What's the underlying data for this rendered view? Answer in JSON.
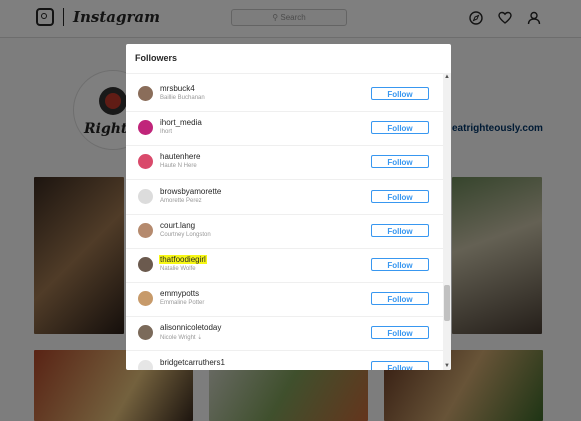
{
  "app": {
    "name": "Instagram"
  },
  "search": {
    "placeholder": "Search"
  },
  "profile": {
    "website": "eatrighteously.com",
    "logo_text": "Righteo"
  },
  "modal": {
    "title": "Followers",
    "followers": [
      {
        "username": "mrsbuck4",
        "full_name": "Baillie Buchanan",
        "button": "Follow",
        "highlight": false,
        "avatar_color": "#8a6d5a"
      },
      {
        "username": "ihort_media",
        "full_name": "Ihort",
        "button": "Follow",
        "highlight": false,
        "avatar_color": "#c0257a"
      },
      {
        "username": "hautenhere",
        "full_name": "Haute N Here",
        "button": "Follow",
        "highlight": false,
        "avatar_color": "#d94a6b"
      },
      {
        "username": "browsbyamorette",
        "full_name": "Amorette Perez",
        "button": "Follow",
        "highlight": false,
        "avatar_color": "#dcdcdc"
      },
      {
        "username": "court.lang",
        "full_name": "Courtney Longston",
        "button": "Follow",
        "highlight": false,
        "avatar_color": "#b58a6e"
      },
      {
        "username": "thatfoodiegirl",
        "full_name": "Natalie Wolfe",
        "button": "Follow",
        "highlight": true,
        "avatar_color": "#6b5a4e"
      },
      {
        "username": "emmypotts",
        "full_name": "Emmaline Potter",
        "button": "Follow",
        "highlight": false,
        "avatar_color": "#c79a6a"
      },
      {
        "username": "alisonnicoletoday",
        "full_name": "Nicole Wright ⇣",
        "button": "Follow",
        "highlight": false,
        "avatar_color": "#7b6a5a"
      },
      {
        "username": "bridgetcarruthers1",
        "full_name": "",
        "button": "Follow",
        "highlight": false,
        "avatar_color": "#e6e6e6"
      }
    ]
  },
  "icons": [
    "instagram-camera-icon",
    "search-icon",
    "compass-icon",
    "heart-icon",
    "user-icon",
    "scroll-up-arrow-icon",
    "scroll-down-arrow-icon"
  ]
}
